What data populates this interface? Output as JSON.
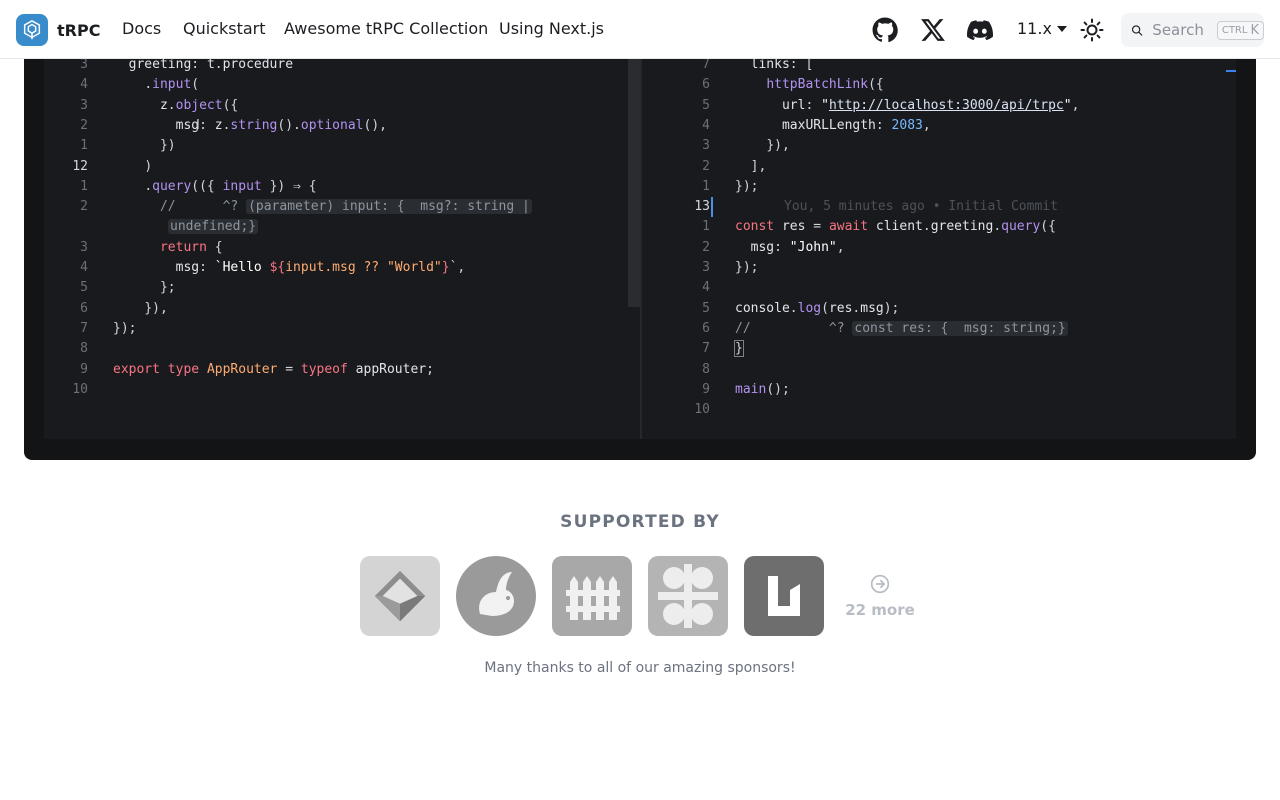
{
  "navbar": {
    "brand": "tRPC",
    "links": [
      "Docs",
      "Quickstart",
      "Awesome tRPC Collection",
      "Using Next.js"
    ],
    "icons": [
      "github-icon",
      "x-twitter-icon",
      "discord-icon"
    ],
    "version": "11.x",
    "theme_icon": "sun-icon",
    "search": {
      "label": "Search",
      "kbd_mod": "CTRL",
      "kbd_key": "K"
    }
  },
  "editor_left": {
    "lines": [
      {
        "n": "3",
        "code": "  greeting: t.procedure"
      },
      {
        "n": "4",
        "code": "    .input("
      },
      {
        "n": "3",
        "code": "      z.object({"
      },
      {
        "n": "2",
        "code": "        msg: z.string().optional(),"
      },
      {
        "n": "1",
        "code": "      })"
      },
      {
        "n": "12",
        "code": "    )"
      },
      {
        "n": "1",
        "code": "    .query(({ input }) ⇒ {"
      },
      {
        "n": "2",
        "code": "      //      ^?"
      },
      {
        "n": "",
        "code": ""
      },
      {
        "n": "3",
        "code": "      return {"
      },
      {
        "n": "4",
        "code": "        msg: `Hello ${input.msg ?? \"World\"}`,"
      },
      {
        "n": "5",
        "code": "      };"
      },
      {
        "n": "6",
        "code": "    }),"
      },
      {
        "n": "7",
        "code": "});"
      },
      {
        "n": "8",
        "code": ""
      },
      {
        "n": "9",
        "code": "export type AppRouter = typeof appRouter;"
      },
      {
        "n": "10",
        "code": ""
      }
    ],
    "hint": "(parameter) input: {  msg?: string |",
    "hint_cont": "undefined;}"
  },
  "editor_right": {
    "lines": [
      {
        "n": "7",
        "code": "  links: ["
      },
      {
        "n": "6",
        "code": "    httpBatchLink({"
      },
      {
        "n": "5",
        "code": "      url: \"http://localhost:3000/api/trpc\","
      },
      {
        "n": "4",
        "code": "      maxURLLength: 2083,"
      },
      {
        "n": "3",
        "code": "    }),"
      },
      {
        "n": "2",
        "code": "  ],"
      },
      {
        "n": "1",
        "code": "});"
      },
      {
        "n": "13",
        "code": ""
      },
      {
        "n": "1",
        "code": "const res = await client.greeting.query({"
      },
      {
        "n": "2",
        "code": "  msg: \"John\","
      },
      {
        "n": "3",
        "code": "});"
      },
      {
        "n": "4",
        "code": ""
      },
      {
        "n": "5",
        "code": "console.log(res.msg);"
      },
      {
        "n": "6",
        "code": "//          ^?"
      },
      {
        "n": "7",
        "code": "}"
      },
      {
        "n": "8",
        "code": ""
      },
      {
        "n": "9",
        "code": "main();"
      },
      {
        "n": "10",
        "code": ""
      }
    ],
    "blame": "You, 5 minutes ago • Initial Commit",
    "hint": "const res: {  msg: string;}"
  },
  "sponsors": {
    "title": "SUPPORTED BY",
    "logos": [
      "cube-logo",
      "rabbit-logo",
      "fence-logo",
      "circles-logo",
      "u-logo"
    ],
    "more": "22 more",
    "thanks": "Many thanks to all of our amazing sponsors!"
  }
}
